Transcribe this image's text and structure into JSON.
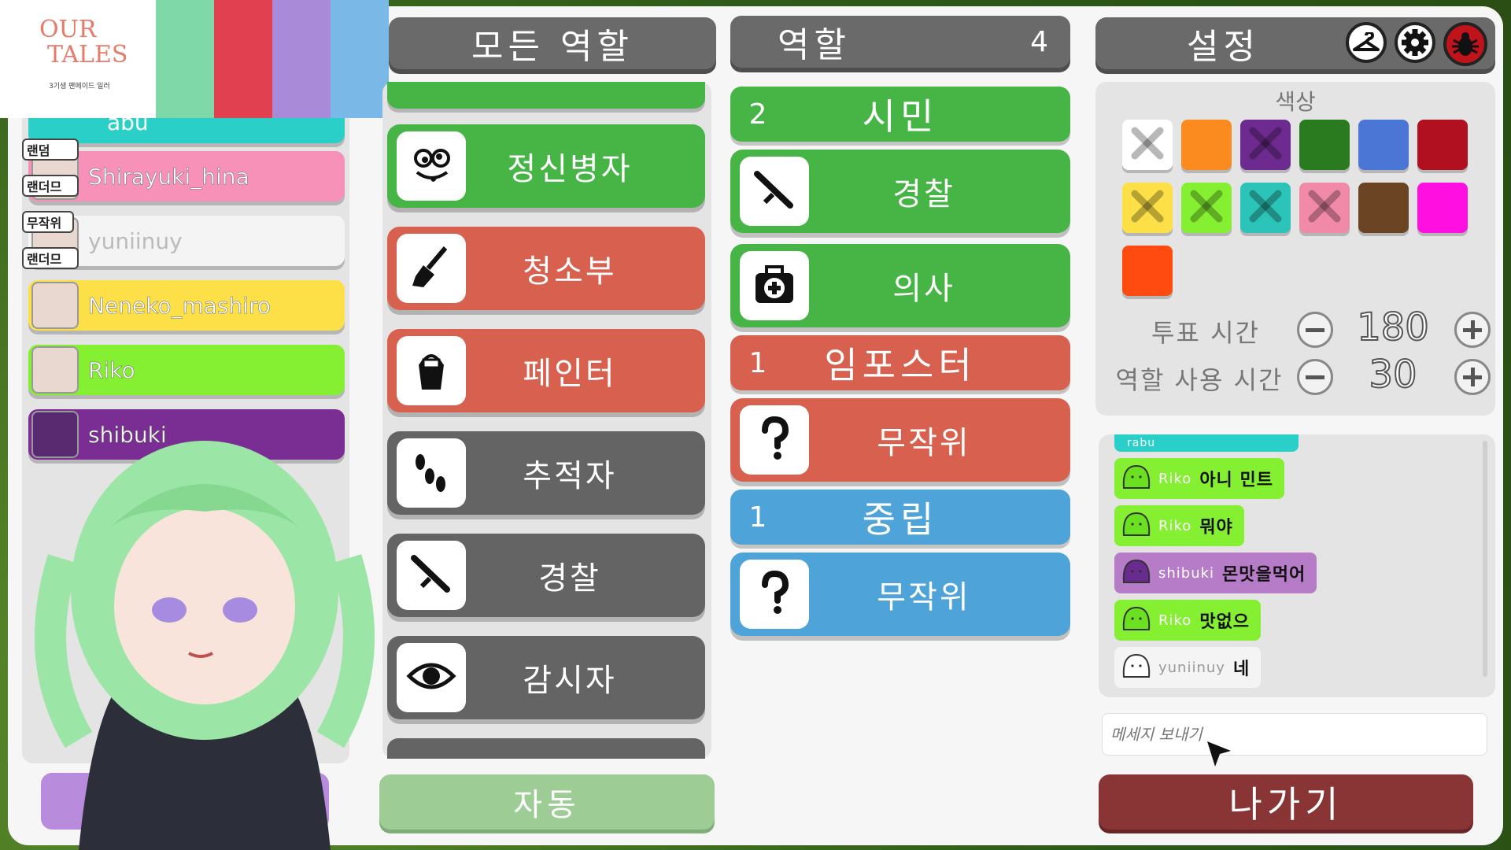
{
  "overlay": {
    "logo_line1": "OUR",
    "logo_line2": "TALES",
    "logo_sub": "3기생 팬메이드 일러"
  },
  "players": {
    "rows": [
      {
        "name": "Shirayuki_hina",
        "color": "#f791b8"
      },
      {
        "name": "yuniinuy",
        "color": "#f4f4f4"
      },
      {
        "name": "Neneko_mashiro",
        "color": "#fde047"
      },
      {
        "name": "Riko",
        "color": "#84f031"
      },
      {
        "name": "shibuki",
        "color": "#7a2e93"
      }
    ],
    "partial_name": "abu",
    "side_labels": [
      "랜덤",
      "랜더므",
      "무작위",
      "랜더므"
    ]
  },
  "all_roles": {
    "title": "모든 역할",
    "items": [
      {
        "label": "정신병자",
        "color": "#46b545",
        "icon": "crazy-face-icon"
      },
      {
        "label": "청소부",
        "color": "#d8604e",
        "icon": "broom-icon"
      },
      {
        "label": "페인터",
        "color": "#d8604e",
        "icon": "paint-bucket-icon"
      },
      {
        "label": "추적자",
        "color": "#646464",
        "icon": "footprints-icon"
      },
      {
        "label": "경찰",
        "color": "#646464",
        "icon": "baton-icon"
      },
      {
        "label": "감시자",
        "color": "#646464",
        "icon": "eye-icon"
      }
    ],
    "auto_button": "자동"
  },
  "roles": {
    "title": "역할",
    "count": "4",
    "groups": [
      {
        "count": "2",
        "name": "시민",
        "color": "#46b545",
        "items": [
          {
            "label": "경찰",
            "icon": "baton-icon"
          },
          {
            "label": "의사",
            "icon": "medkit-icon"
          }
        ]
      },
      {
        "count": "1",
        "name": "임포스터",
        "color": "#d8604e",
        "items": [
          {
            "label": "무작위",
            "icon": "question-icon"
          }
        ]
      },
      {
        "count": "1",
        "name": "중립",
        "color": "#4ea3d8",
        "items": [
          {
            "label": "무작위",
            "icon": "question-icon"
          }
        ]
      }
    ]
  },
  "settings": {
    "title": "설정",
    "color_label": "색상",
    "colors": [
      {
        "hex": "#ffffff",
        "taken": true
      },
      {
        "hex": "#fb8a1f",
        "taken": false
      },
      {
        "hex": "#6e2b8f",
        "taken": true
      },
      {
        "hex": "#2a7a1f",
        "taken": false
      },
      {
        "hex": "#4c76d6",
        "taken": false
      },
      {
        "hex": "#b01020",
        "taken": false
      },
      {
        "hex": "#fde047",
        "taken": true
      },
      {
        "hex": "#84f031",
        "taken": true
      },
      {
        "hex": "#2cc4b8",
        "taken": true
      },
      {
        "hex": "#f08aa8",
        "taken": true
      },
      {
        "hex": "#6a4423",
        "taken": false
      },
      {
        "hex": "#ff10e0",
        "taken": false
      },
      {
        "hex": "#ff4a10",
        "taken": false
      }
    ],
    "vote_label": "투표 시간",
    "vote_value": "180",
    "role_time_label": "역할 사용 시간",
    "role_time_value": "30"
  },
  "chat": {
    "messages": [
      {
        "nick": "Riko",
        "text": "아니 민트",
        "color": "#84f031"
      },
      {
        "nick": "Riko",
        "text": "뭐야",
        "color": "#84f031"
      },
      {
        "nick": "shibuki",
        "text": "몬맛을먹어",
        "color": "#b77cc8"
      },
      {
        "nick": "Riko",
        "text": "맛없으",
        "color": "#84f031"
      },
      {
        "nick": "yuniinuy",
        "text": "네",
        "color": "#f4f4f4"
      }
    ],
    "partial_nick": "rabu",
    "placeholder": "메세지 보내기",
    "exit_button": "나가기"
  }
}
